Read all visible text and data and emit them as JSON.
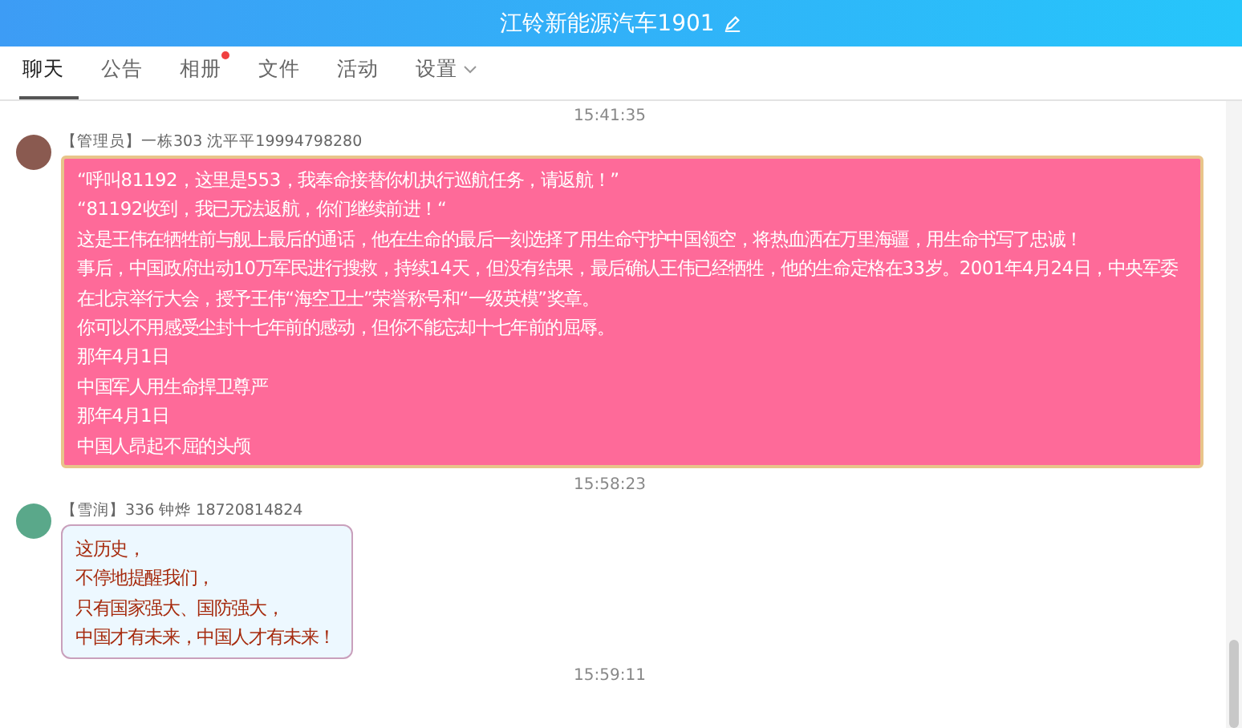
{
  "window": {
    "title": "江铃新能源汽车1901"
  },
  "tabs": [
    {
      "label": "聊天",
      "selected": true,
      "dot": false,
      "kind": "plain"
    },
    {
      "label": "公告",
      "selected": false,
      "dot": false,
      "kind": "plain"
    },
    {
      "label": "相册",
      "selected": false,
      "dot": true,
      "kind": "plain"
    },
    {
      "label": "文件",
      "selected": false,
      "dot": false,
      "kind": "plain"
    },
    {
      "label": "活动",
      "selected": false,
      "dot": false,
      "kind": "plain"
    },
    {
      "label": "设置",
      "selected": false,
      "dot": false,
      "kind": "dropdown"
    }
  ],
  "chat": [
    {
      "kind": "time",
      "text": "15:41:35"
    },
    {
      "kind": "pink_message",
      "sender": "【管理员】一栋303 沈平平19994798280",
      "lines": [
        "“呼叫81192，这里是553，我奉命接替你机执行巡航任务，请返航！”",
        "“81192收到，我已无法返航，你们继续前进！“",
        "这是王伟在牺牲前与舰上最后的通话，他在生命的最后一刻选择了用生命守护中国领空，将热血洒在万里海疆，用生命书写了忠诚！",
        "事后，中国政府出动10万军民进行搜救，持续14天，但没有结果，最后确认王伟已经牺牲，他的生命定格在33岁。2001年4月24日，中央军委在北京举行大会，授予王伟“海空卫士”荣誉称号和“一级英模”奖章。",
        "你可以不用感受尘封十七年前的感动，但你不能忘却十七年前的屈辱。",
        "那年4月1日",
        "中国军人用生命捍卫尊严",
        "那年4月1日",
        "中国人昂起不屈的头颅"
      ]
    },
    {
      "kind": "time",
      "text": "15:58:23"
    },
    {
      "kind": "light_message",
      "sender": "【雪润】336 钟烨 18720814824",
      "lines": [
        "这历史，",
        "不停地提醒我们，",
        "只有国家强大、国防强大，",
        "中国才有未来，中国人才有未来！"
      ]
    },
    {
      "kind": "time",
      "text": "15:59:11"
    }
  ]
}
